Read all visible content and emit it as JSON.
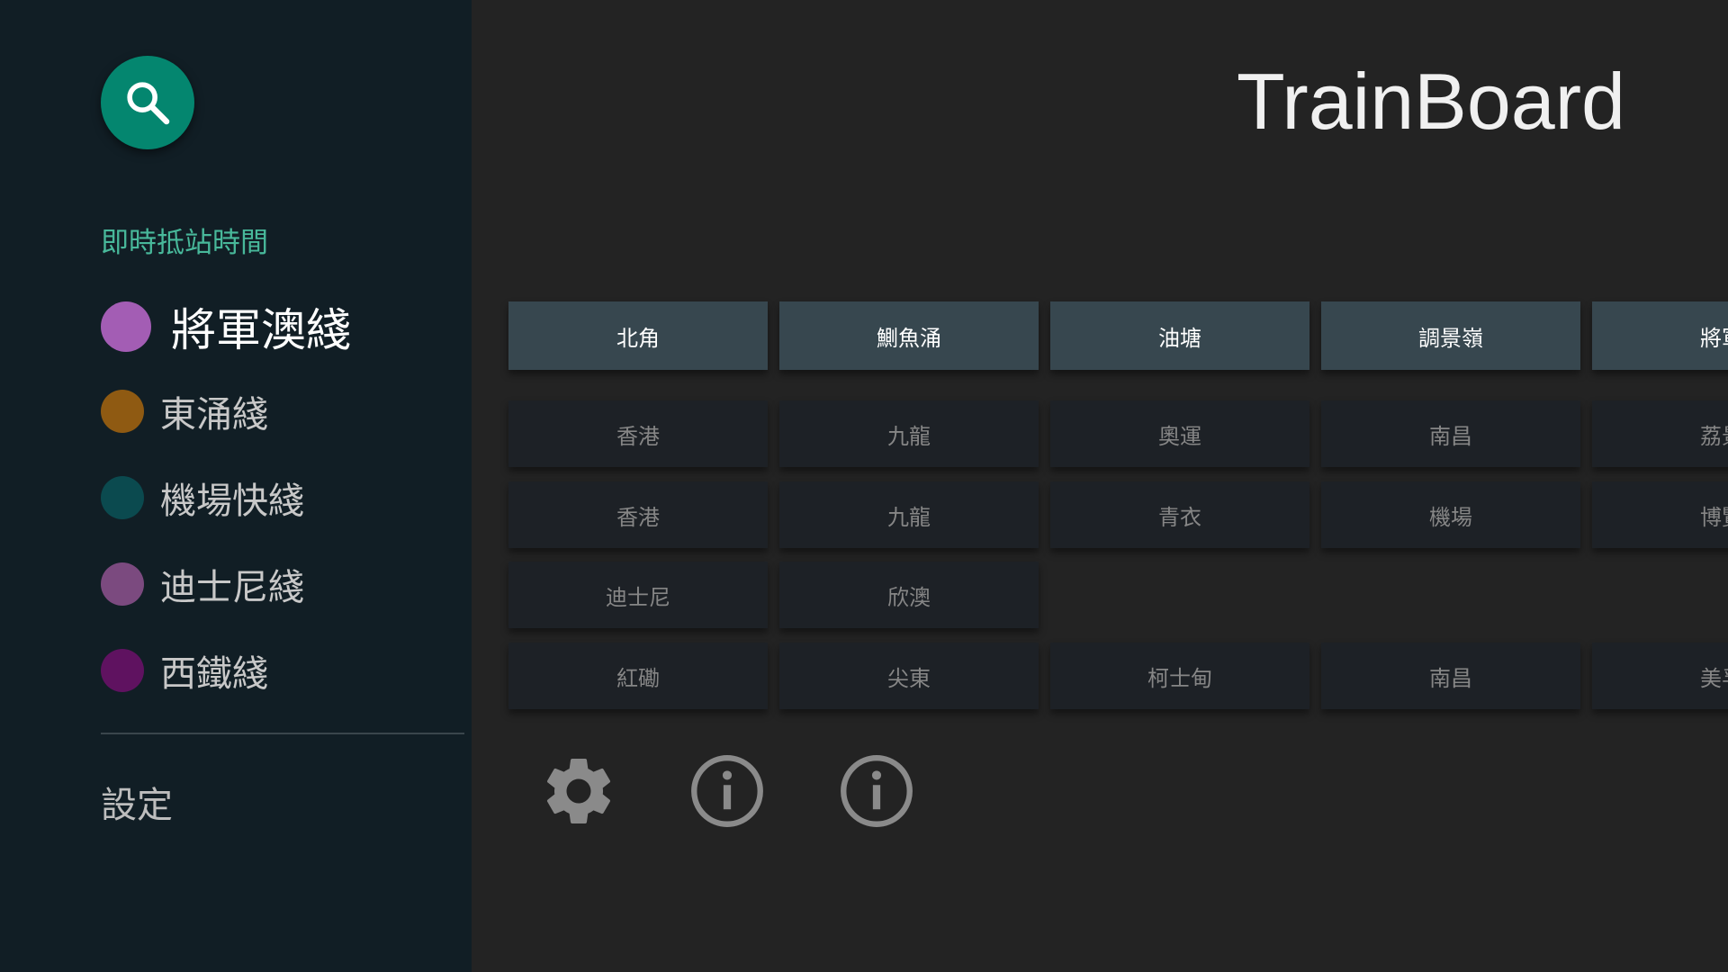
{
  "app_title": "TrainBoard",
  "search": {
    "icon": "search-icon",
    "color": "#04866f"
  },
  "sidebar": {
    "section_header": "即時抵站時間",
    "lines": [
      {
        "label": "將軍澳綫",
        "color": "#a35db4",
        "selected": true
      },
      {
        "label": "東涌綫",
        "color": "#8f5a12"
      },
      {
        "label": "機場快綫",
        "color": "#0b4a4f"
      },
      {
        "label": "迪士尼綫",
        "color": "#7b4a7f"
      },
      {
        "label": "西鐵綫",
        "color": "#5f1260"
      }
    ],
    "settings_label": "設定"
  },
  "grid": {
    "headers": [
      "北角",
      "鰂魚涌",
      "油塘",
      "調景嶺",
      "將軍"
    ],
    "rows": [
      [
        "香港",
        "九龍",
        "奧運",
        "南昌",
        "荔景"
      ],
      [
        "香港",
        "九龍",
        "青衣",
        "機場",
        "博覽"
      ],
      [
        "迪士尼",
        "欣澳",
        "",
        "",
        ""
      ],
      [
        "紅磡",
        "尖東",
        "柯士甸",
        "南昌",
        "美孚"
      ]
    ]
  },
  "bottom_actions": [
    {
      "icon": "gear-icon"
    },
    {
      "icon": "info-icon"
    },
    {
      "icon": "info-icon"
    }
  ]
}
